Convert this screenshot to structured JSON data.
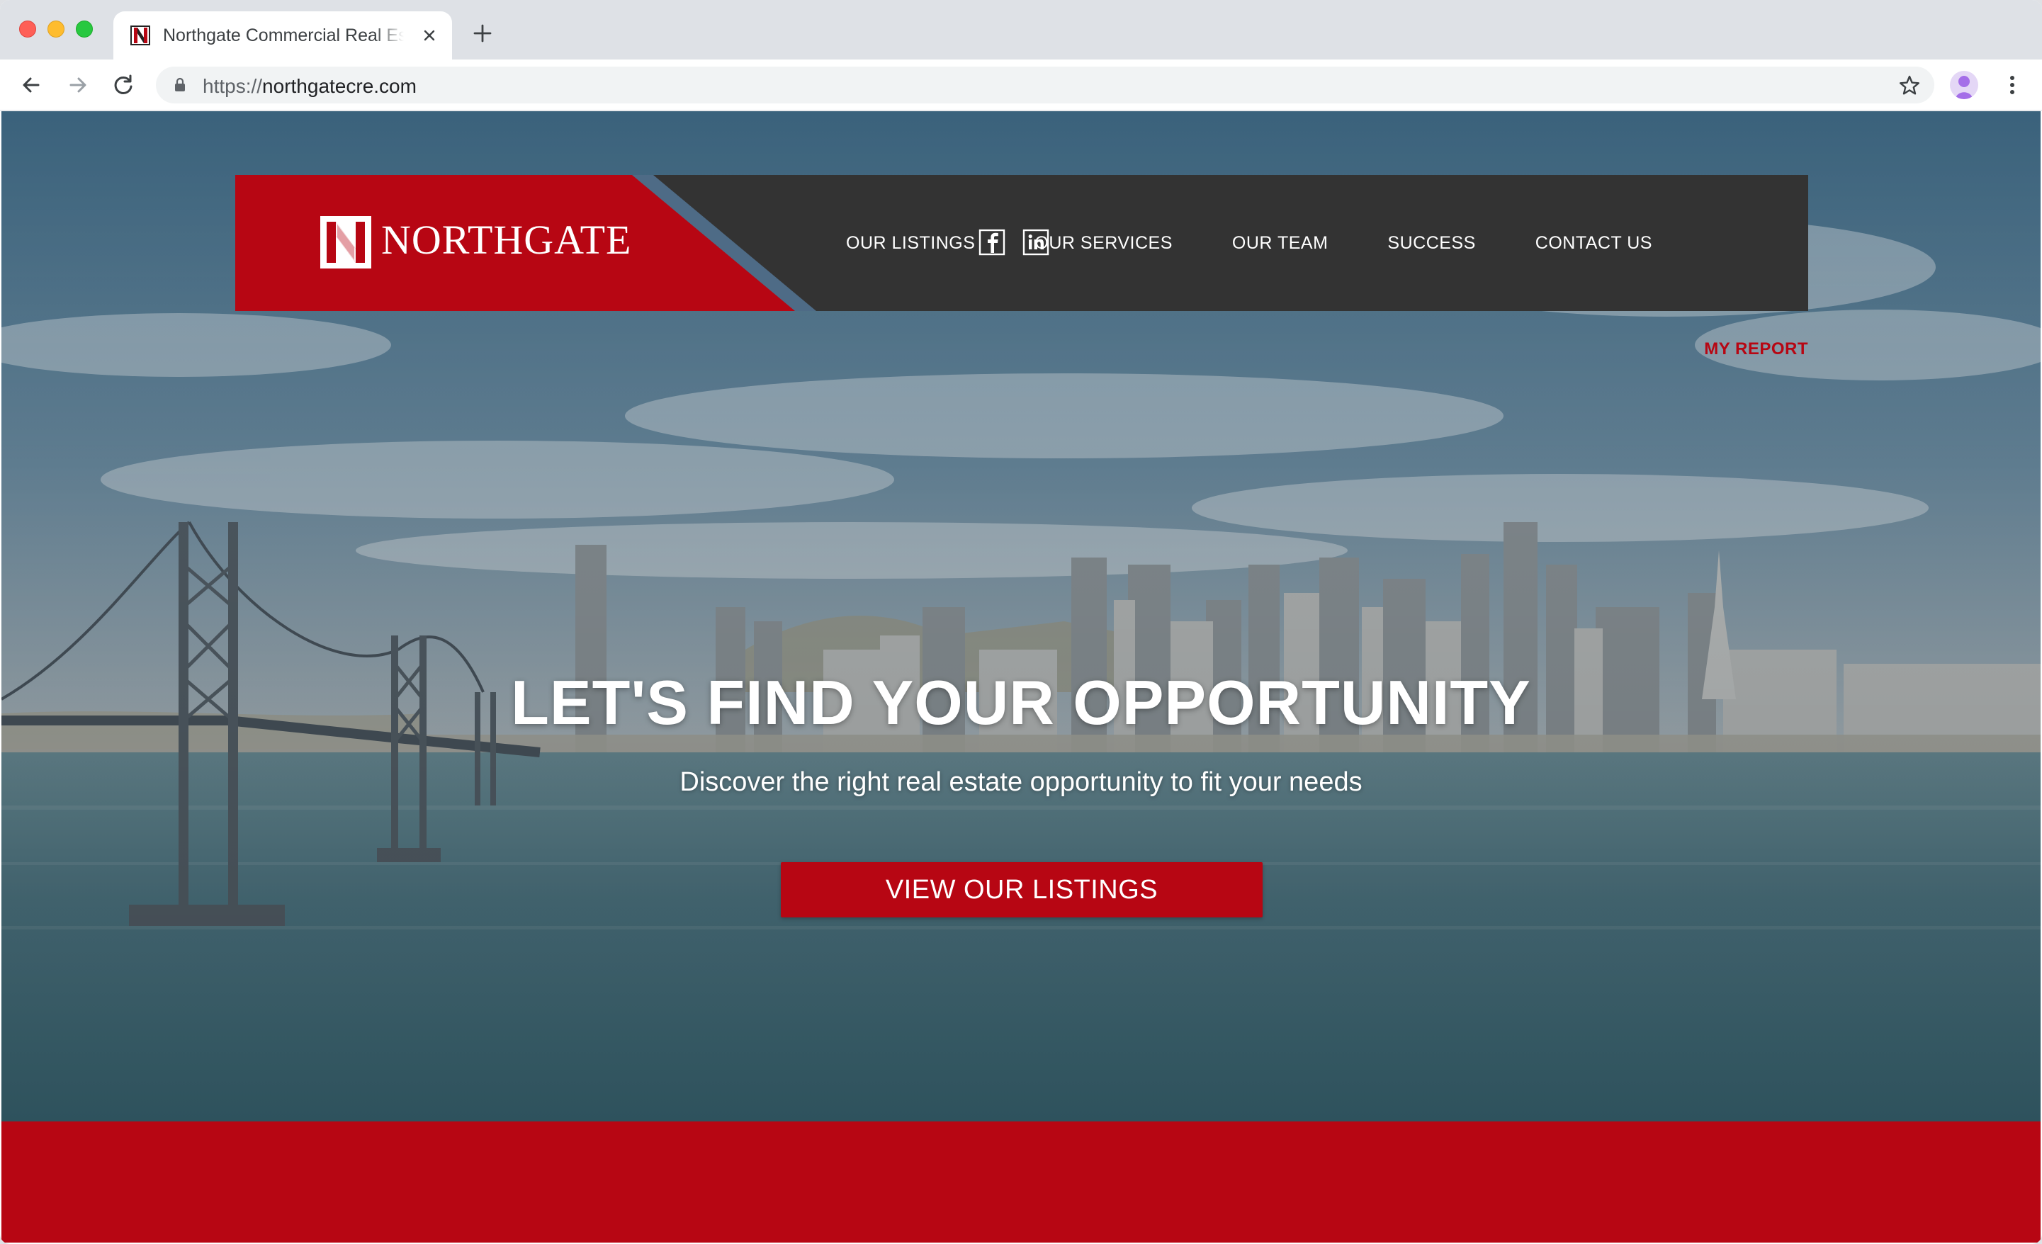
{
  "browser": {
    "tab_title": "Northgate Commercial Real Estate",
    "url_scheme": "https://",
    "url_host": "northgatecre.com"
  },
  "site": {
    "brand_name": "NORTHGATE",
    "nav": {
      "listings": "OUR LISTINGS",
      "services": "OUR SERVICES",
      "team": "OUR TEAM",
      "success": "SUCCESS",
      "contact": "CONTACT US"
    },
    "my_report": "MY REPORT",
    "social_icons": [
      "facebook-icon",
      "linkedin-icon"
    ]
  },
  "hero": {
    "title": "LET'S FIND YOUR OPPORTUNITY",
    "subtitle": "Discover the right real estate opportunity to fit your needs",
    "cta": "VIEW OUR LISTINGS"
  },
  "colors": {
    "brand_red": "#b70613",
    "header_dark": "#333333"
  }
}
